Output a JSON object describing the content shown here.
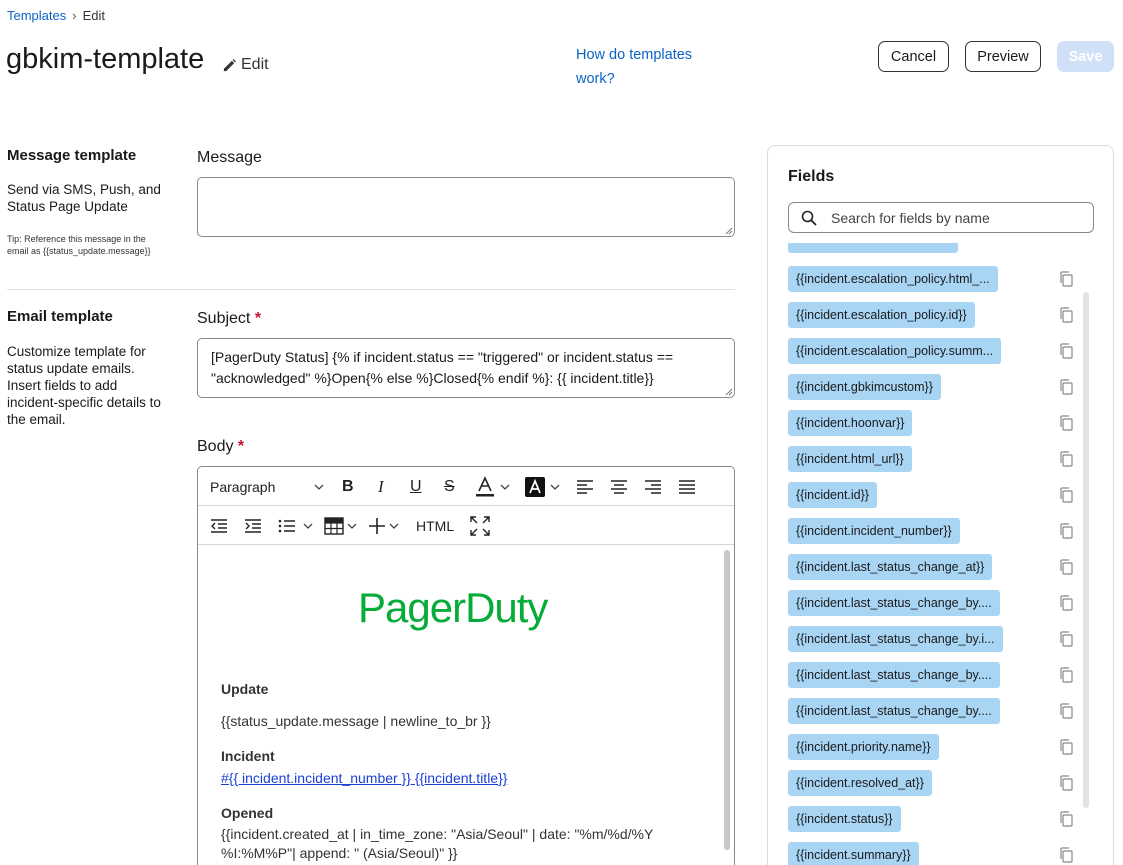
{
  "breadcrumb": {
    "root": "Templates",
    "separator": "›",
    "current": "Edit"
  },
  "header": {
    "title": "gbkim-template",
    "edit_label": "Edit",
    "help_link": "How do templates work?",
    "cancel": "Cancel",
    "preview": "Preview",
    "save": "Save"
  },
  "message_section": {
    "title": "Message template",
    "description": "Send via SMS, Push, and Status Page Update",
    "tip": "Tip: Reference this message in the email as {{status_update.message}}",
    "field_label": "Message",
    "value": ""
  },
  "email_section": {
    "title": "Email template",
    "description": "Customize template for status update emails. Insert fields to add incident-specific details to the email.",
    "subject_label": "Subject",
    "required_mark": "*",
    "subject_value": "[PagerDuty Status] {% if incident.status == \"triggered\" or incident.status == \"acknowledged\" %}Open{% else %}Closed{% endif %}: {{ incident.title}}",
    "body_label": "Body"
  },
  "editor": {
    "paragraph_select": "Paragraph",
    "html_button": "HTML",
    "logo_text": "PagerDuty",
    "update_heading": "Update",
    "update_text": "{{status_update.message | newline_to_br }}",
    "incident_heading": "Incident",
    "incident_link": "#{{ incident.incident_number }} {{incident.title}}",
    "opened_heading": "Opened",
    "opened_text": "{{incident.created_at | in_time_zone: \"Asia/Seoul\" | date: \"%m/%d/%Y %I:%M%P\"| append: \" (Asia/Seoul)\" }}"
  },
  "fields_panel": {
    "title": "Fields",
    "search_placeholder": "Search for fields by name",
    "items": [
      "{{incident.escalation_policy.html_...",
      "{{incident.escalation_policy.id}}",
      "{{incident.escalation_policy.summ...",
      "{{incident.gbkimcustom}}",
      "{{incident.hoonvar}}",
      "{{incident.html_url}}",
      "{{incident.id}}",
      "{{incident.incident_number}}",
      "{{incident.last_status_change_at}}",
      "{{incident.last_status_change_by....",
      "{{incident.last_status_change_by.i...",
      "{{incident.last_status_change_by....",
      "{{incident.last_status_change_by....",
      "{{incident.priority.name}}",
      "{{incident.resolved_at}}",
      "{{incident.status}}",
      "{{incident.summary}}"
    ]
  },
  "colors": {
    "link": "#0b63c4",
    "chip": "#a9d5f5",
    "brand_green": "#06ac38",
    "required": "#c8102e"
  }
}
